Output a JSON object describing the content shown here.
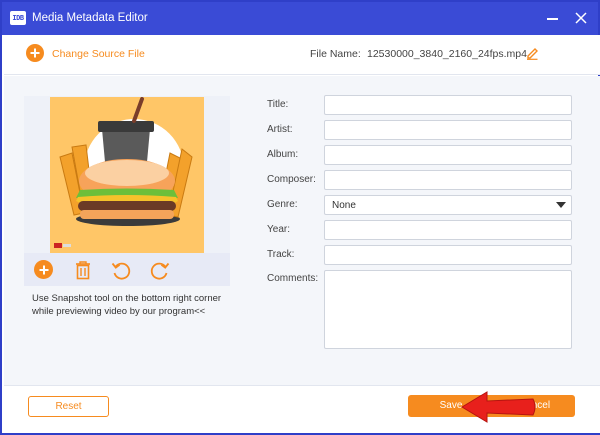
{
  "window": {
    "app_icon_text": "IDB",
    "title": "Media Metadata Editor"
  },
  "toolbar": {
    "change_source_label": "Change Source File",
    "file_name_label": "File Name:",
    "file_name_value": "12530000_3840_2160_24fps.mp4"
  },
  "preview": {
    "hint": "Use Snapshot tool on the bottom right corner while previewing video by our program<<"
  },
  "form": {
    "title_label": "Title:",
    "artist_label": "Artist:",
    "album_label": "Album:",
    "composer_label": "Composer:",
    "genre_label": "Genre:",
    "genre_value": "None",
    "year_label": "Year:",
    "track_label": "Track:",
    "comments_label": "Comments:",
    "title_value": "",
    "artist_value": "",
    "album_value": "",
    "composer_value": "",
    "year_value": "",
    "track_value": "",
    "comments_value": ""
  },
  "footer": {
    "reset_label": "Reset",
    "save_label": "Save",
    "cancel_label": "Cancel"
  },
  "colors": {
    "titlebar": "#3a4bd6",
    "accent": "#f68b1f",
    "annotation_arrow": "#e8201c"
  },
  "icons": {
    "toolbar": [
      "add-circle-icon",
      "edit-pencil-icon"
    ],
    "preview_toolbar": [
      "add-circle-icon",
      "trash-icon",
      "rotate-left-icon",
      "rotate-right-icon"
    ],
    "window": [
      "minimize-icon",
      "close-icon"
    ]
  }
}
